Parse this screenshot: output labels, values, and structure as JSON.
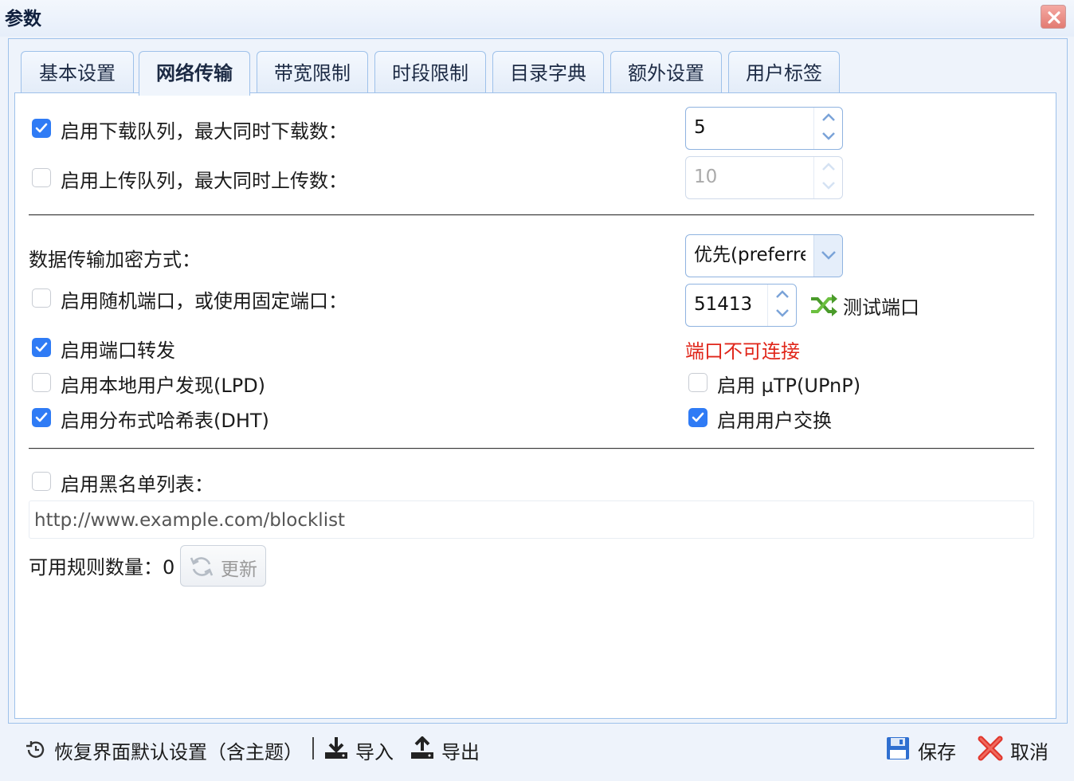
{
  "window": {
    "title": "参数"
  },
  "tabs": [
    {
      "label": "基本设置",
      "active": false
    },
    {
      "label": "网络传输",
      "active": true
    },
    {
      "label": "带宽限制",
      "active": false
    },
    {
      "label": "时段限制",
      "active": false
    },
    {
      "label": "目录字典",
      "active": false
    },
    {
      "label": "额外设置",
      "active": false
    },
    {
      "label": "用户标签",
      "active": false
    }
  ],
  "queue": {
    "download": {
      "label": "启用下载队列，最大同时下载数：",
      "checked": true,
      "value": "5"
    },
    "upload": {
      "label": "启用上传队列，最大同时上传数：",
      "checked": false,
      "value": "10"
    }
  },
  "encryption": {
    "label": "数据传输加密方式：",
    "value": "优先(preferred)"
  },
  "port": {
    "random_label": "启用随机端口，或使用固定端口：",
    "random_checked": false,
    "value": "51413",
    "test_label": "测试端口",
    "status": "端口不可连接",
    "status_color": "#e0261a"
  },
  "options": {
    "port_forwarding": {
      "label": "启用端口转发",
      "checked": true
    },
    "lpd": {
      "label": "启用本地用户发现(LPD)",
      "checked": false
    },
    "dht": {
      "label": "启用分布式哈希表(DHT)",
      "checked": true
    },
    "utp": {
      "label": "启用 µTP(UPnP)",
      "checked": false
    },
    "pex": {
      "label": "启用用户交换",
      "checked": true
    }
  },
  "blocklist": {
    "label": "启用黑名单列表：",
    "checked": false,
    "url_placeholder": "http://www.example.com/blocklist",
    "rules_label": "可用规则数量：",
    "rules_count": "0",
    "refresh_label": "更新"
  },
  "footer": {
    "restore_label": "恢复界面默认设置（含主题）",
    "import_label": "导入",
    "export_label": "导出",
    "save_label": "保存",
    "cancel_label": "取消"
  },
  "colors": {
    "accent": "#2f7bf5",
    "border": "#9ec1ea",
    "error": "#e0261a"
  }
}
